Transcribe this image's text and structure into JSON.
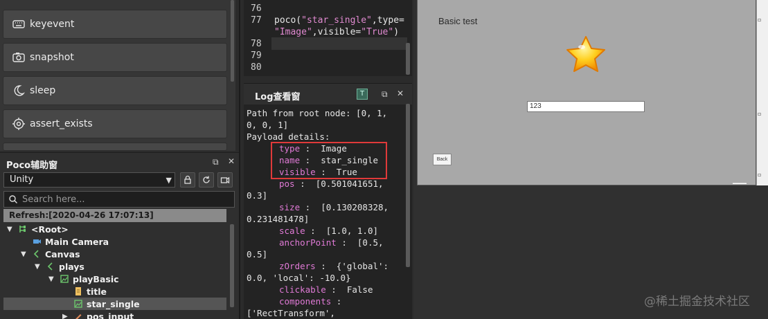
{
  "airtest_buttons": [
    {
      "label": "keyevent",
      "icon": "keyboard-icon"
    },
    {
      "label": "snapshot",
      "icon": "camera-icon"
    },
    {
      "label": "sleep",
      "icon": "moon-icon"
    },
    {
      "label": "assert_exists",
      "icon": "target-icon"
    }
  ],
  "poco": {
    "title": "Poco辅助窗",
    "platform": "Unity",
    "search_placeholder": "Search here...",
    "refresh": "Refresh:[2020-04-26 17:07:13]",
    "tree": [
      {
        "label": "<Root>",
        "level": 0
      },
      {
        "label": "Main Camera",
        "level": 1
      },
      {
        "label": "Canvas",
        "level": 1
      },
      {
        "label": "plays",
        "level": 2
      },
      {
        "label": "playBasic",
        "level": 3
      },
      {
        "label": "title",
        "level": 4
      },
      {
        "label": "star_single",
        "level": 4,
        "selected": true
      },
      {
        "label": "pos_input",
        "level": 4
      }
    ]
  },
  "editor": {
    "line_numbers": [
      "76",
      "77",
      "",
      "78",
      "79",
      "80"
    ],
    "line77_a": "poco(",
    "line77_str1": "\"star_single\"",
    "line77_b": ",type=",
    "line77_str2": "\"Image\"",
    "line77_c": ",visible=",
    "line77_str3": "\"True\"",
    "line77_d": ")"
  },
  "log": {
    "title": "Log查看窗",
    "path_1": "Path from root node: [0, 1,",
    "path_2": "0, 0, 1]",
    "payload": "Payload details:",
    "fields": [
      {
        "k": "type",
        "v": "Image"
      },
      {
        "k": "name",
        "v": "star_single"
      },
      {
        "k": "visible",
        "v": "True"
      },
      {
        "k": "pos",
        "v": "[0.501041651,"
      },
      {
        "k": "",
        "v": "0.3]"
      },
      {
        "k": "size",
        "v": "[0.130208328,"
      },
      {
        "k": "",
        "v": "0.231481478]"
      },
      {
        "k": "scale",
        "v": "[1.0, 1.0]"
      },
      {
        "k": "anchorPoint",
        "v": "[0.5,"
      },
      {
        "k": "",
        "v": "0.5]"
      },
      {
        "k": "zOrders",
        "v": "{'global':"
      },
      {
        "k": "",
        "v": "0.0, 'local': -10.0}"
      },
      {
        "k": "clickable",
        "v": "False"
      },
      {
        "k": "components",
        "v": ""
      },
      {
        "k": "",
        "v": "['RectTransform',"
      }
    ]
  },
  "device": {
    "scene_title": "Basic test",
    "input_value": "123",
    "back_label": "Back"
  },
  "watermark": "@稀土掘金技术社区",
  "colors": {
    "accent_key": "#e07ad6",
    "highlight_box": "#e03a3a",
    "device_bg": "#a8a8a8"
  }
}
